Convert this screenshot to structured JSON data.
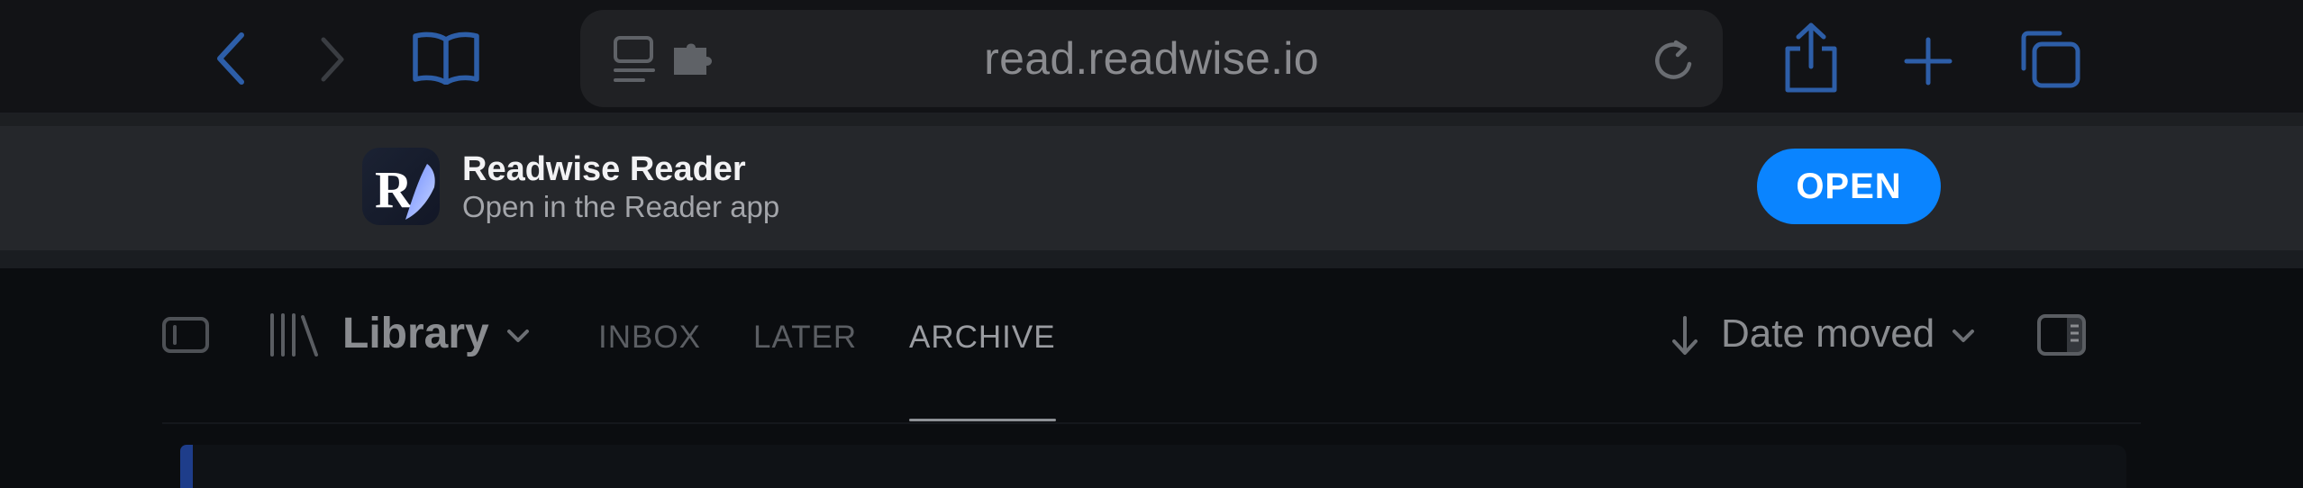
{
  "browser": {
    "url": "read.readwise.io",
    "icons": [
      "back-icon",
      "forward-icon",
      "bookmarks-icon",
      "reader-icon",
      "extensions-icon",
      "reload-icon",
      "share-icon",
      "new-tab-icon",
      "tabs-icon"
    ],
    "accent_color": "#0a84ff"
  },
  "banner": {
    "app_name": "Readwise Reader",
    "subtitle": "Open in the Reader app",
    "open_label": "OPEN",
    "icon_letter": "R"
  },
  "header": {
    "library_label": "Library",
    "tabs": [
      {
        "label": "INBOX",
        "active": false
      },
      {
        "label": "LATER",
        "active": false
      },
      {
        "label": "ARCHIVE",
        "active": true
      }
    ],
    "sort_label": "Date moved"
  }
}
